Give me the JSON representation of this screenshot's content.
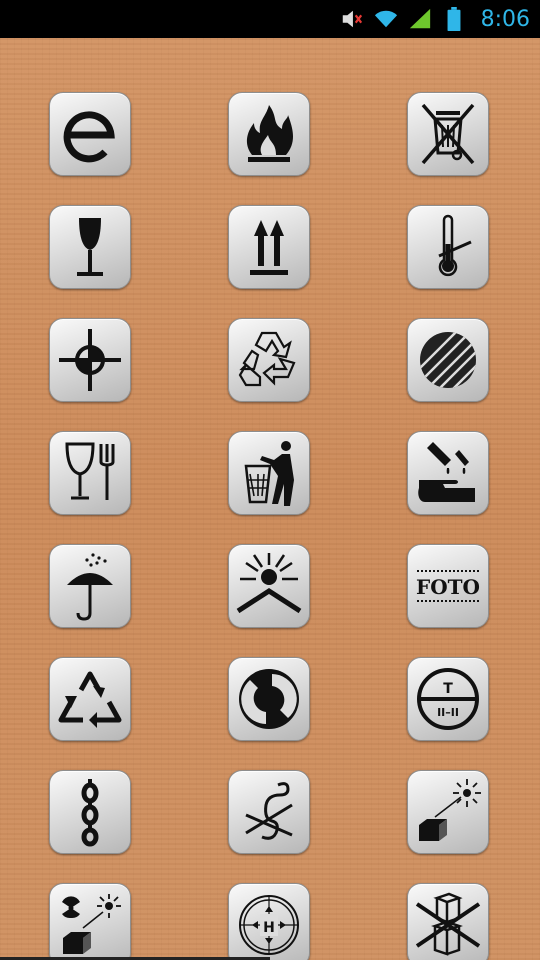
{
  "status_bar": {
    "time": "8:06",
    "icons": [
      "mute-icon",
      "wifi-icon",
      "signal-icon",
      "battery-icon"
    ],
    "accent_color": "#2fb6e8"
  },
  "symbols": [
    {
      "name": "estimated-sign-icon"
    },
    {
      "name": "flammable-icon"
    },
    {
      "name": "crossed-out-bin-icon"
    },
    {
      "name": "fragile-glass-icon"
    },
    {
      "name": "this-way-up-icon"
    },
    {
      "name": "temperature-limit-icon"
    },
    {
      "name": "centre-of-gravity-icon"
    },
    {
      "name": "mobius-recycle-icon"
    },
    {
      "name": "striped-circle-icon"
    },
    {
      "name": "food-safe-icon"
    },
    {
      "name": "tidyman-icon"
    },
    {
      "name": "corrosive-icon"
    },
    {
      "name": "keep-dry-icon"
    },
    {
      "name": "keep-away-from-sunlight-icon"
    },
    {
      "name": "foto-icon"
    },
    {
      "name": "recycle-triangle-icon"
    },
    {
      "name": "green-dot-icon"
    },
    {
      "name": "clamp-here-icon"
    },
    {
      "name": "sling-here-icon"
    },
    {
      "name": "no-hooks-icon"
    },
    {
      "name": "protect-from-radiation-icon"
    },
    {
      "name": "protect-from-heat-and-radiation-icon"
    },
    {
      "name": "heat-sensitive-icon"
    },
    {
      "name": "do-not-stack-icon"
    }
  ],
  "foto_label": "FOTO",
  "clamp_labels": {
    "top": "T",
    "bottom": "II–II"
  },
  "clamp_hint": "H"
}
